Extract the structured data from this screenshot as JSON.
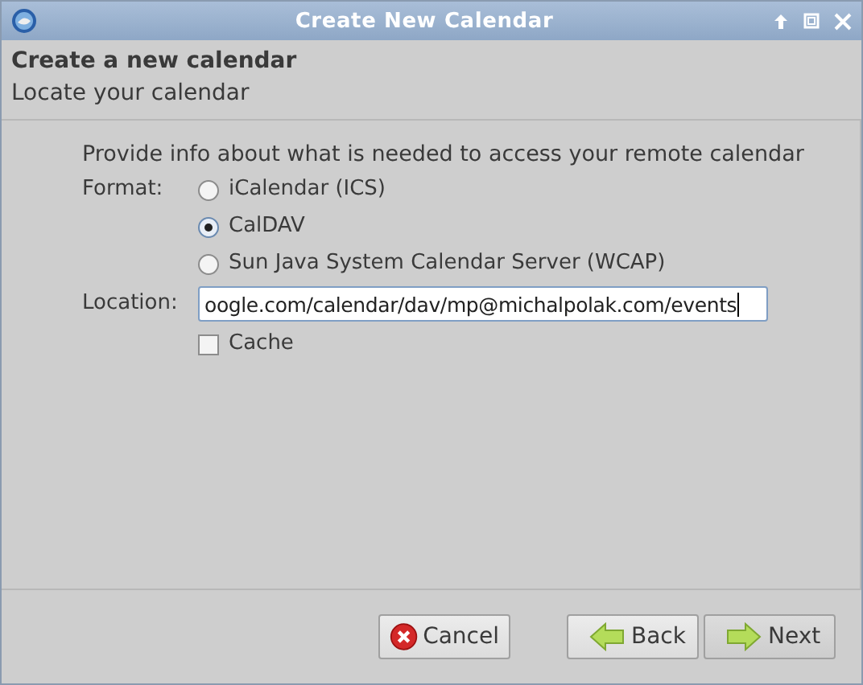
{
  "window": {
    "title": "Create New Calendar"
  },
  "header": {
    "title": "Create a new calendar",
    "subtitle": "Locate your calendar"
  },
  "intro": "Provide info about what is needed to access your remote calendar",
  "format": {
    "label": "Format:",
    "options": [
      {
        "label": "iCalendar (ICS)",
        "selected": false
      },
      {
        "label": "CalDAV",
        "selected": true
      },
      {
        "label": "Sun Java System Calendar Server (WCAP)",
        "selected": false
      }
    ]
  },
  "location": {
    "label": "Location:",
    "value": "oogle.com/calendar/dav/mp@michalpolak.com/events"
  },
  "cache": {
    "label": "Cache",
    "checked": false
  },
  "buttons": [
    {
      "kind": "cancel",
      "label": "Cancel"
    },
    {
      "kind": "back",
      "label": "Back"
    },
    {
      "kind": "next",
      "label": "Next"
    }
  ]
}
